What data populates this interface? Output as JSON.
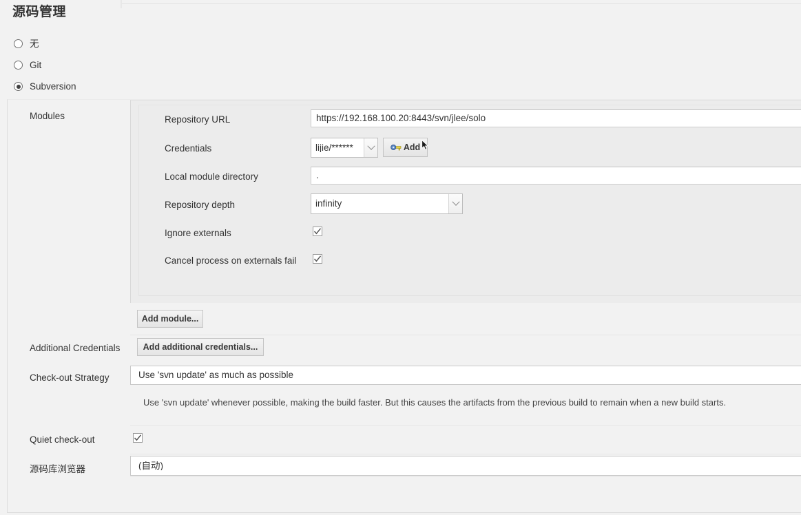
{
  "section": {
    "title": "源码管理"
  },
  "scm_options": [
    {
      "label": "无",
      "selected": false
    },
    {
      "label": "Git",
      "selected": false
    },
    {
      "label": "Subversion",
      "selected": true
    }
  ],
  "modules": {
    "label": "Modules",
    "fields": {
      "repository_url": {
        "label": "Repository URL",
        "value": "https://192.168.100.20:8443/svn/jlee/solo"
      },
      "credentials": {
        "label": "Credentials",
        "value": "lijie/******",
        "add_button": "Add"
      },
      "local_module_directory": {
        "label": "Local module directory",
        "value": "."
      },
      "repository_depth": {
        "label": "Repository depth",
        "value": "infinity"
      },
      "ignore_externals": {
        "label": "Ignore externals",
        "checked": true
      },
      "cancel_process_on_externals_fail": {
        "label": "Cancel process on externals fail",
        "checked": true
      }
    },
    "add_module_button": "Add module..."
  },
  "additional_credentials": {
    "label": "Additional Credentials",
    "button": "Add additional credentials..."
  },
  "checkout_strategy": {
    "label": "Check-out Strategy",
    "value": "Use 'svn update' as much as possible",
    "description": "Use 'svn update' whenever possible, making the build faster. But this causes the artifacts from the previous build to remain when a new build starts."
  },
  "quiet_checkout": {
    "label": "Quiet check-out",
    "checked": true
  },
  "repository_browser": {
    "label": "源码库浏览器",
    "value": "(自动)"
  },
  "colors": {
    "page_bg": "#f2f2f2",
    "panel_bg": "#ececec",
    "text": "#333333",
    "border": "#dcdcdc",
    "key_icon_head": "#5b87c4",
    "key_icon_shaft": "#e8d44a"
  }
}
